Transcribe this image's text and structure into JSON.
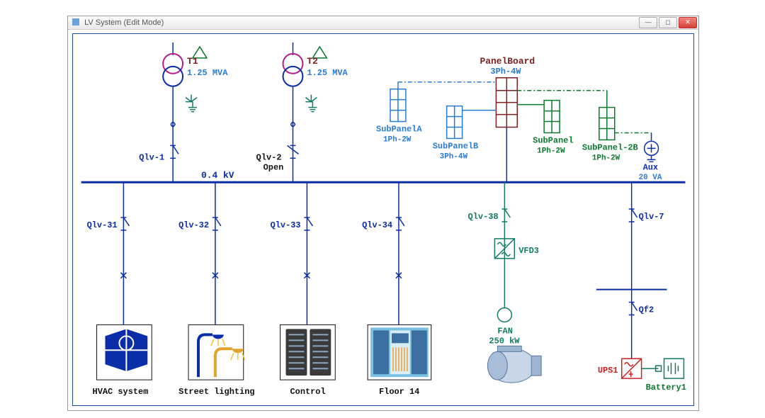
{
  "window": {
    "title": "LV System (Edit Mode)"
  },
  "bus": {
    "voltage_label": "0.4 kV"
  },
  "transformers": {
    "t1": {
      "name": "T1",
      "rating": "1.25 MVA"
    },
    "t2": {
      "name": "T2",
      "rating": "1.25 MVA"
    }
  },
  "upper_breakers": {
    "qlv1": {
      "name": "Qlv-1"
    },
    "qlv2": {
      "name": "Qlv-2",
      "state": "Open"
    }
  },
  "panels": {
    "main": {
      "name": "PanelBoard",
      "spec": "3Ph-4W"
    },
    "subA": {
      "name": "SubPanelA",
      "spec": "1Ph-2W"
    },
    "subB": {
      "name": "SubPanelB",
      "spec": "3Ph-4W"
    },
    "sub1": {
      "name": "SubPanel",
      "spec": "1Ph-2W"
    },
    "sub2b": {
      "name": "SubPanel-2B",
      "spec": "1Ph-2W"
    },
    "aux": {
      "name": "Aux",
      "rating": "20 VA"
    }
  },
  "feeders": {
    "f1": {
      "breaker": "Qlv-31",
      "label": "HVAC system"
    },
    "f2": {
      "breaker": "Qlv-32",
      "label": "Street lighting"
    },
    "f3": {
      "breaker": "Qlv-33",
      "label": "Control"
    },
    "f4": {
      "breaker": "Qlv-34",
      "label": "Floor 14"
    },
    "f5": {
      "breaker": "Qlv-38",
      "vfd": "VFD3",
      "load": "FAN",
      "rating": "250 kW"
    },
    "f6": {
      "breaker": "Qlv-7",
      "sub_breaker": "Qf2",
      "ups": "UPS1",
      "battery": "Battery1"
    }
  }
}
